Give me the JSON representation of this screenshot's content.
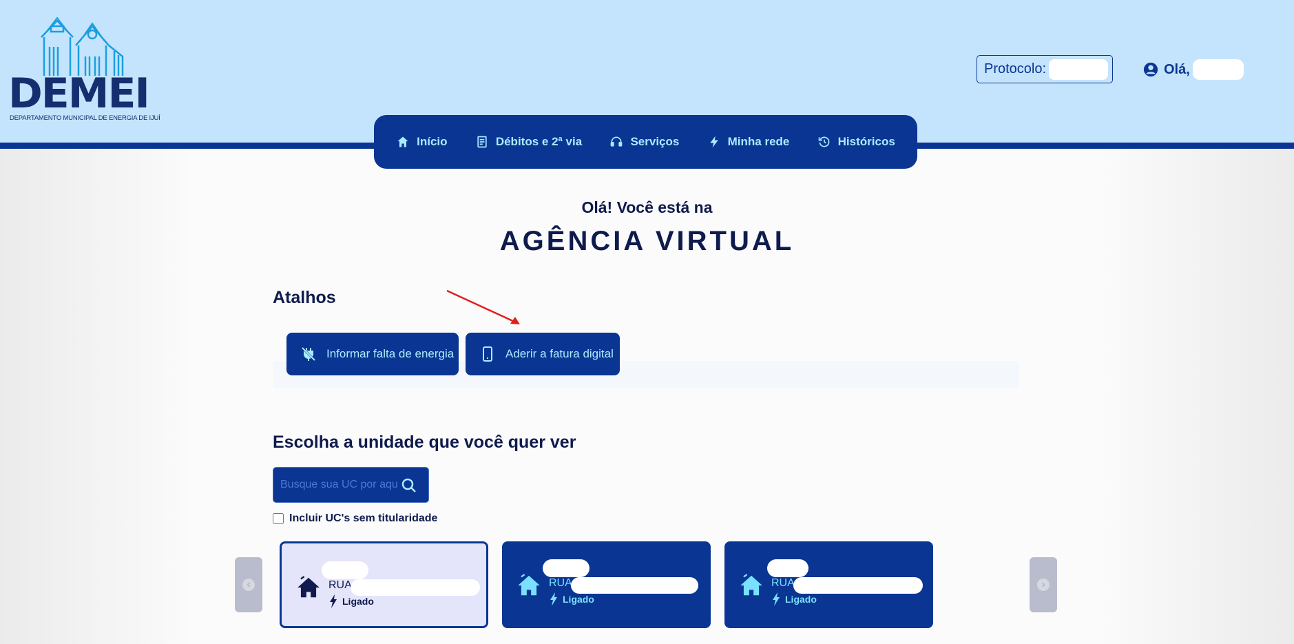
{
  "header": {
    "logo_text": "DEMEI",
    "logo_subtitle": "DEPARTAMENTO MUNICIPAL DE ENERGIA DE IJUÍ",
    "protocol_label": "Protocolo:",
    "greeting": "Olá,"
  },
  "nav": {
    "items": [
      {
        "label": "Início",
        "icon": "home-icon"
      },
      {
        "label": "Débitos e 2ª via",
        "icon": "receipt-icon"
      },
      {
        "label": "Serviços",
        "icon": "headset-icon"
      },
      {
        "label": "Minha rede",
        "icon": "lightning-icon"
      },
      {
        "label": "Históricos",
        "icon": "history-icon"
      }
    ]
  },
  "hero": {
    "subtitle": "Olá! Você está na",
    "title": "AGÊNCIA VIRTUAL"
  },
  "shortcuts": {
    "title": "Atalhos",
    "buttons": [
      {
        "label": "Informar falta de energia",
        "icon": "plug-off-icon"
      },
      {
        "label": "Aderir a fatura digital",
        "icon": "phone-icon"
      }
    ]
  },
  "units": {
    "title": "Escolha a unidade que você quer ver",
    "search_placeholder": "Busque sua UC por aqui",
    "include_label": "Incluir UC's sem titularidade",
    "cards": [
      {
        "street_prefix": "RUA",
        "status": "Ligado",
        "selected": true
      },
      {
        "street_prefix": "RUA",
        "status": "Ligado",
        "selected": false
      },
      {
        "street_prefix": "RUA",
        "status": "Ligado",
        "selected": false
      }
    ]
  },
  "colors": {
    "header_bg": "#c4e4fd",
    "primary": "#0a3593",
    "accent_text": "#a9ecff",
    "dark_text": "#0f1b4d"
  }
}
